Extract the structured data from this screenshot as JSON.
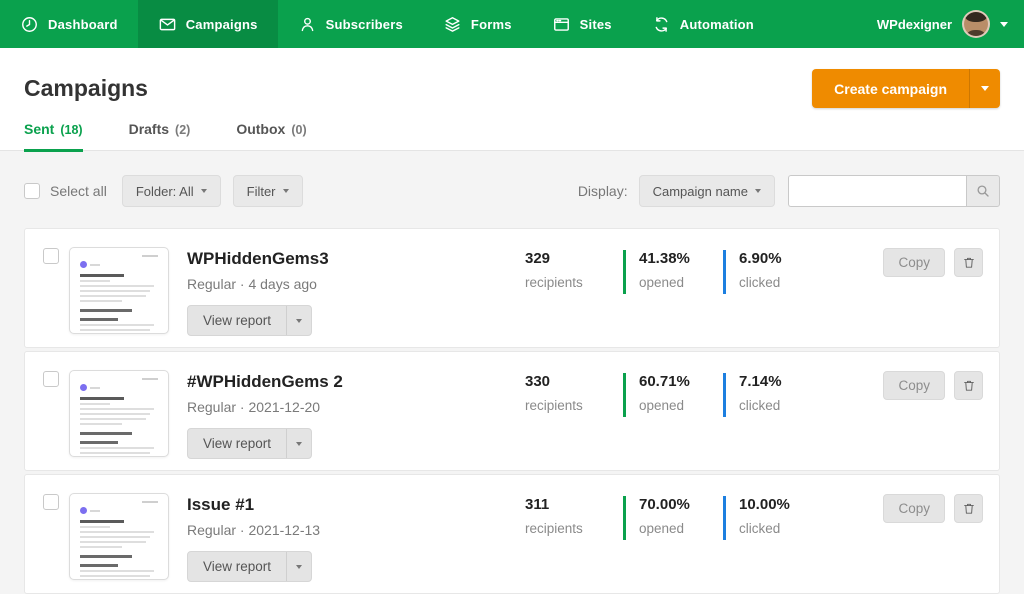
{
  "nav": {
    "items": [
      {
        "label": "Dashboard",
        "icon": "dashboard-icon",
        "active": false
      },
      {
        "label": "Campaigns",
        "icon": "campaigns-icon",
        "active": true
      },
      {
        "label": "Subscribers",
        "icon": "subscribers-icon",
        "active": false
      },
      {
        "label": "Forms",
        "icon": "forms-icon",
        "active": false
      },
      {
        "label": "Sites",
        "icon": "sites-icon",
        "active": false
      },
      {
        "label": "Automation",
        "icon": "automation-icon",
        "active": false
      }
    ],
    "user_name": "WPdexigner"
  },
  "header": {
    "title": "Campaigns",
    "create_button_label": "Create campaign"
  },
  "tabs": [
    {
      "label": "Sent",
      "count": "(18)",
      "active": true
    },
    {
      "label": "Drafts",
      "count": "(2)",
      "active": false
    },
    {
      "label": "Outbox",
      "count": "(0)",
      "active": false
    }
  ],
  "toolbar": {
    "select_all_label": "Select all",
    "folder_button": "Folder: All",
    "filter_button": "Filter",
    "display_label": "Display:",
    "display_value": "Campaign name",
    "search_placeholder": ""
  },
  "row_labels": {
    "recipients": "recipients",
    "opened": "opened",
    "clicked": "clicked",
    "view_report": "View report",
    "copy": "Copy"
  },
  "campaigns": [
    {
      "name": "WPHiddenGems3",
      "meta": "Regular · 4 days ago",
      "recipients": "329",
      "opened": "41.38%",
      "clicked": "6.90%"
    },
    {
      "name": "#WPHiddenGems 2",
      "meta": "Regular · 2021-12-20",
      "recipients": "330",
      "opened": "60.71%",
      "clicked": "7.14%"
    },
    {
      "name": "Issue #1",
      "meta": "Regular · 2021-12-13",
      "recipients": "311",
      "opened": "70.00%",
      "clicked": "10.00%"
    }
  ],
  "colors": {
    "nav_green": "#0aa14d",
    "nav_active_green": "#088c43",
    "accent_orange": "#ef8b00",
    "opened_bar_green": "#0aa14d",
    "clicked_bar_blue": "#1c7fe0"
  }
}
